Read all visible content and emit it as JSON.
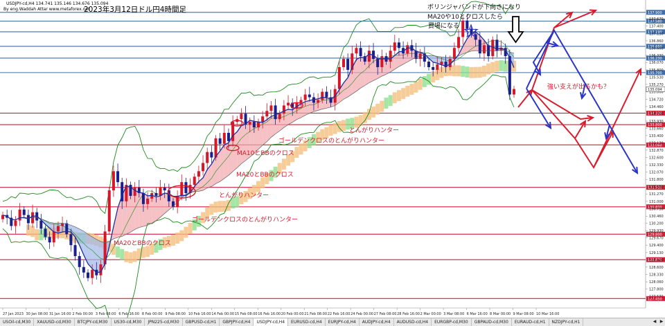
{
  "window": {
    "symbol_line": "USDJPY-cd,H4  134.741 135.146 134.676 135.094",
    "credit": "By eng.Waddah Attar  www.metaforex.net",
    "title": "2023年3月12日ドル円4時間足"
  },
  "annotations": {
    "note1": "ボリンジャバンドが下向きになり",
    "note2": "MA20や10とクロスしたら",
    "note3": "買場になる",
    "hunter1": "とんがりハンター",
    "gc1": "ゴールデンクロスのとんがりハンター",
    "ma10bb": "MA10とBBのクロス",
    "ma20bb1": "MA20とBBのクロス",
    "hunter2": "とんがりハンター",
    "gc2": "ゴールデンクロスのとんがりハンター",
    "ma20bb2": "MA20とBBのクロス",
    "support": "強い支えが出るかも？"
  },
  "tabs": [
    {
      "label": "USOil-cd,M30",
      "active": false
    },
    {
      "label": "XAUUSD-cd,M30",
      "active": false
    },
    {
      "label": "BTCJPY-cd,M30",
      "active": false
    },
    {
      "label": "US30-cd,M30",
      "active": false
    },
    {
      "label": "JPN225-cd,M30",
      "active": false
    },
    {
      "label": "GBPUSD-cd,H1",
      "active": false
    },
    {
      "label": "GBPJPY-cd,H4",
      "active": false
    },
    {
      "label": "USDJPY-cd,H4",
      "active": true
    },
    {
      "label": "EURUSD-cd,H4",
      "active": false
    },
    {
      "label": "EURJPY-cd,H4",
      "active": false
    },
    {
      "label": "AUDJPY-cd,H4",
      "active": false
    },
    {
      "label": "AUDUSD-cd,H4",
      "active": false
    },
    {
      "label": "EURGBP-cd,M30",
      "active": false
    },
    {
      "label": "GBPAUD-cd,M30",
      "active": false
    },
    {
      "label": "EURAUD-cd,H1",
      "active": false
    },
    {
      "label": "NZDJPY-cd,H1",
      "active": false
    }
  ],
  "colors": {
    "bull": "#d6172a",
    "bear": "#1a1f8c",
    "bb": "#1d8a1d",
    "ma_fast": "#1c2f9c",
    "ma_slow": "#606060",
    "cloud": "#f4c07f",
    "cloud2": "#8fe08f",
    "level_red": "#cf2038",
    "level_blue": "#3f6ea8",
    "arrow_red": "#d91c2c",
    "arrow_blue": "#2a35c8"
  },
  "chart_data": {
    "type": "candlestick",
    "symbol": "USDJPY-cd",
    "timeframe": "H4",
    "ohlc_header": {
      "open": 134.741,
      "high": 135.146,
      "low": 134.676,
      "close": 135.094
    },
    "ylim": [
      127.13,
      138.3
    ],
    "y_ticks": [
      137.67,
      137.4,
      137.13,
      136.86,
      136.6,
      136.33,
      136.07,
      135.8,
      135.53,
      135.27,
      135.0,
      134.72,
      134.46,
      134.2,
      133.93,
      133.66,
      133.4,
      133.13,
      132.87,
      132.6,
      132.33,
      132.07,
      131.8,
      131.53,
      131.27,
      131.0,
      130.73,
      130.46,
      130.2,
      129.93,
      129.67,
      129.4,
      129.13,
      128.86,
      128.6,
      128.33,
      128.06,
      127.8,
      127.53
    ],
    "x_ticks": [
      "27 Jan 2023",
      "30 Jan 08:00",
      "31 Jan 16:00",
      "2 Feb 00:00",
      "3 Feb 08:00",
      "6 Feb 16:00",
      "8 Feb 00:00",
      "9 Feb 08:00",
      "10 Feb 16:00",
      "14 Feb 00:00",
      "15 Feb 08:00",
      "16 Feb 16:00",
      "20 Feb 00:00",
      "21 Feb 08:00",
      "22 Feb 16:00",
      "24 Feb 00:00",
      "27 Feb 08:00",
      "28 Feb 16:00",
      "2 Mar 00:00",
      "3 Mar 08:00",
      "6 Mar 16:00",
      "8 Mar 00:00",
      "9 Mar 08:00",
      "10 Mar 16:00"
    ],
    "horizontal_levels": [
      {
        "price": 137.9,
        "label": "137.900",
        "color": "blue"
      },
      {
        "price": 137.58,
        "label": "137.580",
        "color": "blue"
      },
      {
        "price": 137.19,
        "label": "137.190",
        "color": "blue"
      },
      {
        "price": 136.66,
        "label": "136.660",
        "color": "blue"
      },
      {
        "price": 136.23,
        "label": "136.230",
        "color": "blue"
      },
      {
        "price": 135.7,
        "label": "135.700",
        "color": "blue"
      },
      {
        "price": 134.22,
        "label": "134.220",
        "color": "red"
      },
      {
        "price": 133.8,
        "label": "133.800",
        "color": "red"
      },
      {
        "price": 133.06,
        "label": "133.060",
        "color": "red"
      },
      {
        "price": 131.51,
        "label": "131.510",
        "color": "red"
      },
      {
        "price": 130.8,
        "label": "130.800",
        "color": "red"
      },
      {
        "price": 129.8,
        "label": "129.800",
        "color": "red"
      },
      {
        "price": 128.87,
        "label": "128.870",
        "color": "red"
      },
      {
        "price": 127.45,
        "label": "127.450",
        "color": "red"
      }
    ],
    "current_price": {
      "value": 135.094,
      "label": "135.094"
    },
    "candles_close": [
      130.5,
      130.4,
      130.1,
      130.3,
      130.7,
      130.5,
      130.2,
      130.6,
      130.3,
      130.0,
      129.7,
      129.5,
      129.9,
      130.1,
      130.2,
      129.8,
      129.4,
      129.0,
      128.6,
      128.4,
      128.2,
      128.5,
      128.3,
      128.7,
      129.9,
      131.4,
      132.1,
      131.7,
      131.0,
      131.6,
      131.2,
      131.5,
      131.3,
      130.9,
      131.1,
      131.3,
      131.2,
      131.5,
      131.4,
      131.0,
      130.8,
      131.2,
      131.7,
      131.3,
      131.6,
      131.9,
      132.1,
      132.4,
      132.8,
      132.6,
      133.3,
      133.1,
      133.5,
      133.2,
      133.9,
      134.0,
      134.2,
      133.8,
      133.9,
      133.7,
      133.9,
      134.1,
      134.3,
      134.5,
      134.0,
      134.2,
      134.5,
      134.6,
      134.4,
      134.6,
      134.7,
      134.9,
      134.8,
      134.6,
      134.7,
      135.0,
      134.8,
      134.6,
      135.1,
      135.9,
      136.2,
      135.8,
      136.4,
      136.6,
      136.3,
      136.1,
      136.5,
      136.2,
      135.9,
      136.3,
      136.1,
      136.5,
      136.8,
      136.6,
      136.4,
      136.7,
      136.5,
      136.2,
      136.4,
      136.1,
      135.9,
      135.8,
      136.0,
      136.1,
      135.9,
      136.2,
      136.6,
      137.0,
      137.6,
      137.3,
      137.1,
      136.9,
      136.4,
      136.7,
      136.3,
      136.9,
      136.5,
      136.6,
      136.3,
      134.9,
      135.1
    ],
    "series": [
      {
        "name": "BB upper"
      },
      {
        "name": "BB middle"
      },
      {
        "name": "BB lower"
      },
      {
        "name": "MA fast"
      },
      {
        "name": "MA slow"
      }
    ],
    "forecast_paths": {
      "red_up": [
        [
          735,
          -0.6
        ],
        [
          800,
          -0.25
        ],
        [
          850,
          0.08
        ],
        [
          890,
          0.45
        ]
      ],
      "blue_down": [
        [
          735,
          1.2
        ],
        [
          800,
          0.95
        ],
        [
          850,
          0.55
        ],
        [
          890,
          0.3
        ]
      ]
    }
  }
}
